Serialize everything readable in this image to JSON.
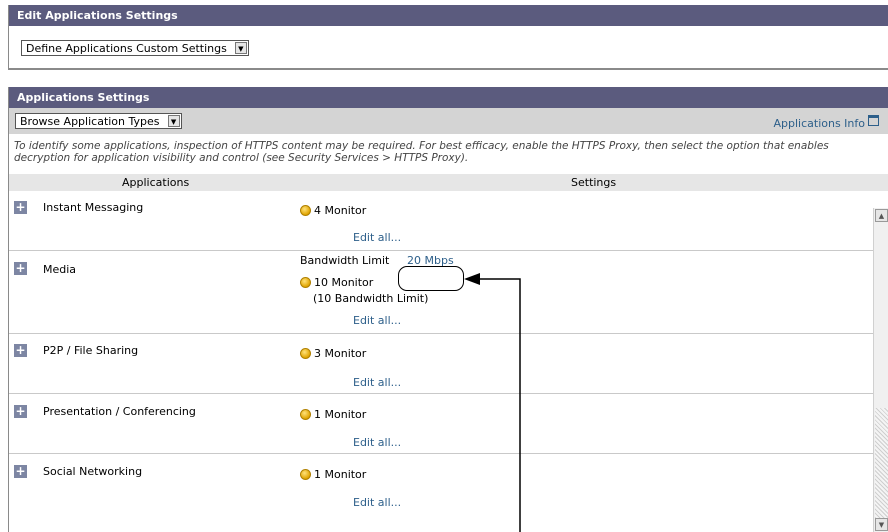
{
  "edit_panel": {
    "title": "Edit Applications Settings",
    "select_value": "Define Applications Custom Settings"
  },
  "app_panel": {
    "title": "Applications Settings",
    "browse_select_value": "Browse Application Types",
    "info_link": "Applications Info",
    "note": "To identify some applications, inspection of HTTPS content may be required. For best efficacy, enable the HTTPS Proxy, then select the option that enables decryption for application visibility and control (see Security Services > HTTPS Proxy).",
    "col_applications": "Applications",
    "col_settings": "Settings",
    "rows": [
      {
        "name": "Instant Messaging",
        "monitor": "4 Monitor",
        "edit": "Edit all..."
      },
      {
        "name": "Media",
        "bandwidth_label": "Bandwidth Limit",
        "bandwidth_value": "20 Mbps",
        "monitor": "10 Monitor",
        "sub": "(10 Bandwidth Limit)",
        "edit": "Edit all..."
      },
      {
        "name": "P2P / File Sharing",
        "monitor": "3 Monitor",
        "edit": "Edit all..."
      },
      {
        "name": "Presentation / Conferencing",
        "monitor": "1 Monitor",
        "edit": "Edit all..."
      },
      {
        "name": "Social Networking",
        "monitor": "1 Monitor",
        "edit": "Edit all..."
      }
    ],
    "expand_symbol": "+"
  }
}
